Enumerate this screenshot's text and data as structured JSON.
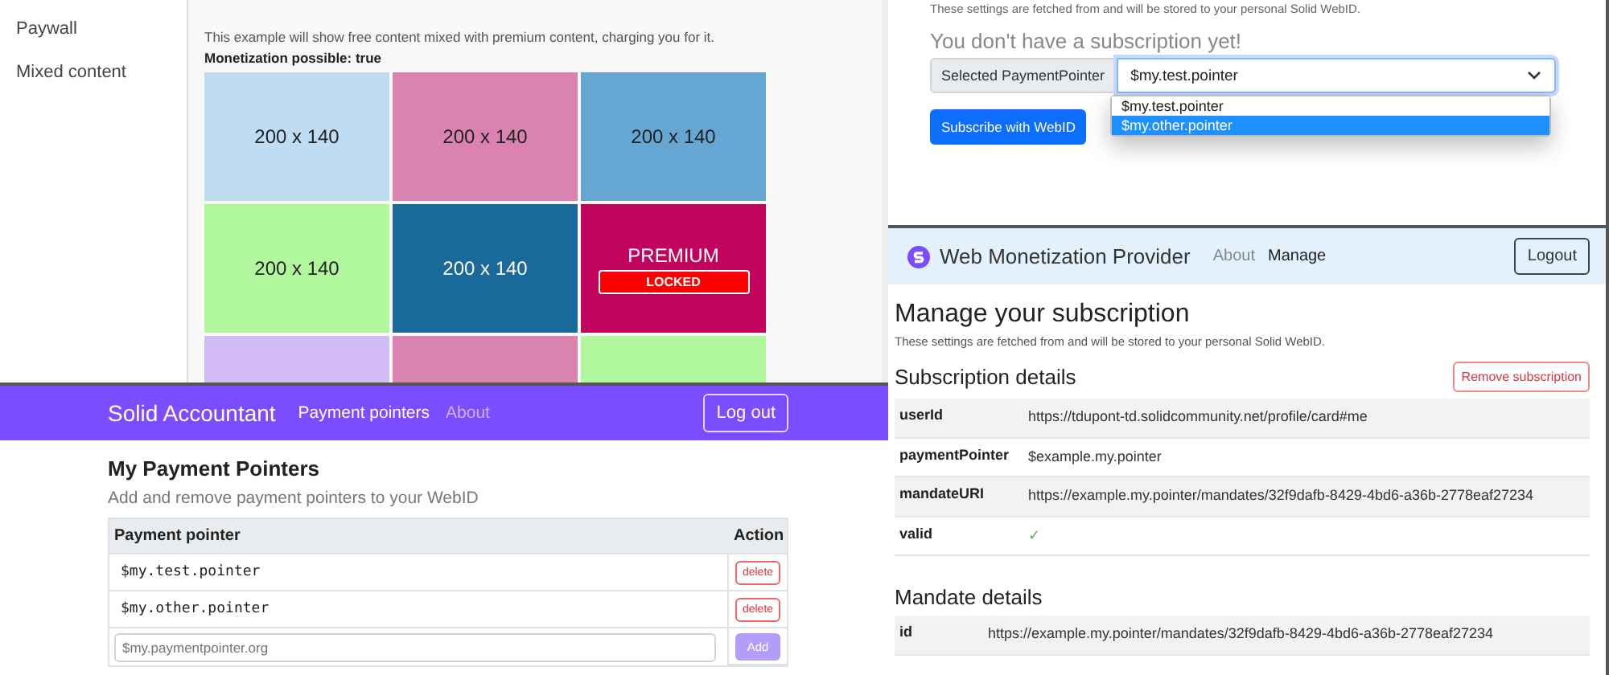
{
  "mixed_content_demo": {
    "sidebar": {
      "items": [
        {
          "label": "Paywall"
        },
        {
          "label": "Mixed content"
        }
      ]
    },
    "description": "This example will show free content mixed with premium content, charging you for it.",
    "status": "Monetization possible: true",
    "tiles": [
      {
        "kind": "placeholder",
        "label": "200 x 140",
        "color": "#bfdcf5"
      },
      {
        "kind": "placeholder",
        "label": "200 x 140",
        "color": "#da83b1"
      },
      {
        "kind": "placeholder",
        "label": "200 x 140",
        "color": "#66a6d2"
      },
      {
        "kind": "placeholder",
        "label": "200 x 140",
        "color": "#b1f79e"
      },
      {
        "kind": "placeholder",
        "label": "200 x 140",
        "color": "#196a9a"
      },
      {
        "kind": "premium",
        "label": "PREMIUM",
        "badge": "LOCKED",
        "color": "#c0045e"
      },
      {
        "kind": "blank",
        "color": "#d3bbf7"
      },
      {
        "kind": "blank",
        "color": "#da83b1"
      },
      {
        "kind": "blank",
        "color": "#b1f79e"
      }
    ]
  },
  "subscribe_page": {
    "intro": "These settings are fetched from and will be stored to your personal Solid WebID.",
    "notice": "You don't have a subscription yet!",
    "select": {
      "label": "Selected PaymentPointer",
      "value": "$my.test.pointer",
      "expanded": true,
      "options": [
        {
          "label": "$my.test.pointer",
          "highlighted": false
        },
        {
          "label": "$my.other.pointer",
          "highlighted": true
        }
      ]
    },
    "button": "Subscribe with WebID"
  },
  "provider": {
    "brand": "Web Monetization Provider",
    "nav": [
      {
        "label": "About",
        "selected": false
      },
      {
        "label": "Manage",
        "selected": true
      }
    ],
    "logout": "Logout",
    "heading": "Manage your subscription",
    "intro": "These settings are fetched from and will be stored to your personal Solid WebID.",
    "subscription": {
      "title": "Subscription details",
      "remove": "Remove subscription",
      "rows": [
        {
          "key": "userId",
          "value": "https://tdupont-td.solidcommunity.net/profile/card#me"
        },
        {
          "key": "paymentPointer",
          "value": "$example.my.pointer"
        },
        {
          "key": "mandateURI",
          "value": "https://example.my.pointer/mandates/32f9dafb-8429-4bd6-a36b-2778eaf27234"
        },
        {
          "key": "valid",
          "value": "✓"
        }
      ]
    },
    "mandate": {
      "title": "Mandate details",
      "rows": [
        {
          "key": "id",
          "value": "https://example.my.pointer/mandates/32f9dafb-8429-4bd6-a36b-2778eaf27234"
        }
      ]
    }
  },
  "accountant": {
    "brand": "Solid Accountant",
    "nav": [
      {
        "label": "Payment pointers",
        "selected": true
      },
      {
        "label": "About",
        "selected": false
      }
    ],
    "logout": "Log out",
    "heading": "My Payment Pointers",
    "subtitle": "Add and remove payment pointers to your WebID",
    "table": {
      "columns": [
        "Payment pointer",
        "Action"
      ],
      "rows": [
        {
          "pointer": "$my.test.pointer",
          "action": "delete"
        },
        {
          "pointer": "$my.other.pointer",
          "action": "delete"
        }
      ],
      "new_entry": {
        "placeholder": "$my.paymentpointer.org",
        "button": "Add",
        "disabled": true
      }
    }
  }
}
